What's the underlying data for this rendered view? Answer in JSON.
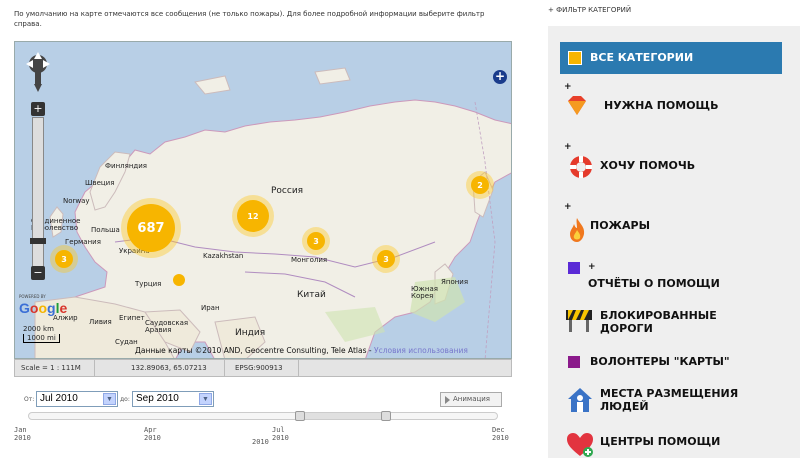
{
  "intro": "По умолчанию на карте отмечаются все сообщения (не только пожары). Для более подробной информации выберите фильтр справа.",
  "map": {
    "labels": {
      "russia": "Россия",
      "china": "Китай",
      "kazakhstan": "Kazakhstan",
      "mongolia": "Монголия",
      "ukraine": "Украина",
      "sweden": "Швеция",
      "norway": "Norway",
      "finland": "Финляндия",
      "uk": "Соединенное Королевство",
      "germany": "Германия",
      "poland": "Польша",
      "turkey": "Турция",
      "algeria": "Алжир",
      "libya": "Ливия",
      "egypt": "Египет",
      "saudi": "Саудовская Аравия",
      "india": "Индия",
      "iran": "Иран",
      "japan": "Япония",
      "korea": "Южная Корея",
      "sudan": "Судан"
    },
    "clusters": {
      "c687": "687",
      "c12": "12",
      "c3_west": "3",
      "c3_center": "3",
      "c3_east": "3",
      "c2": "2"
    },
    "powered_by": "POWERED BY",
    "google": "Google",
    "scale_km": "2000 km",
    "scale_mi": "1000 mi",
    "attribution": "Данные карты ©2010 AND, Geocentre Consulting, Tele Atlas - ",
    "terms_link": "Условия использования",
    "zoom_in": "+",
    "zoom_out": "−",
    "layer_switcher": "+"
  },
  "status": {
    "scale": "Scale = 1 : 111M",
    "coords": "132.89063, 65.07213",
    "epsg": "EPSG:900913"
  },
  "time": {
    "from_label": "От:",
    "from_value": "Jul 2010",
    "to_label": "до:",
    "to_value": "Sep 2010",
    "animation": "Анимация",
    "ticks": [
      {
        "month": "Jan",
        "year": "2010"
      },
      {
        "month": "Apr",
        "year": "2010"
      },
      {
        "month": "Jul",
        "year": "2010"
      },
      {
        "month": "Dec",
        "year": "2010"
      }
    ],
    "center_year": "2010"
  },
  "sidebar": {
    "filter_head": "+ ФИЛЬТР КАТЕГОРИЙ",
    "categories": {
      "all": "ВСЕ КАТЕГОРИИ",
      "need_help": "НУЖНА ПОМОЩЬ",
      "want_help": "ХОЧУ ПОМОЧЬ",
      "fires": "ПОЖАРЫ",
      "reports": "ОТЧЁТЫ О ПОМОЩИ",
      "roads_1": "БЛОКИРОВАННЫЕ",
      "roads_2": "ДОРОГИ",
      "volunteers": "ВОЛОНТЕРЫ \"КАРТЫ\"",
      "shelter_1": "МЕСТА РАЗМЕЩЕНИЯ",
      "shelter_2": "ЛЮДЕЙ",
      "help_centers": "ЦЕНТРЫ ПОМОЩИ"
    },
    "plus": "+",
    "colors": {
      "all": "#f7b500",
      "reports": "#5a2ad6",
      "volunteers": "#8b1a8b",
      "active_bg": "#2b7ab0"
    }
  }
}
